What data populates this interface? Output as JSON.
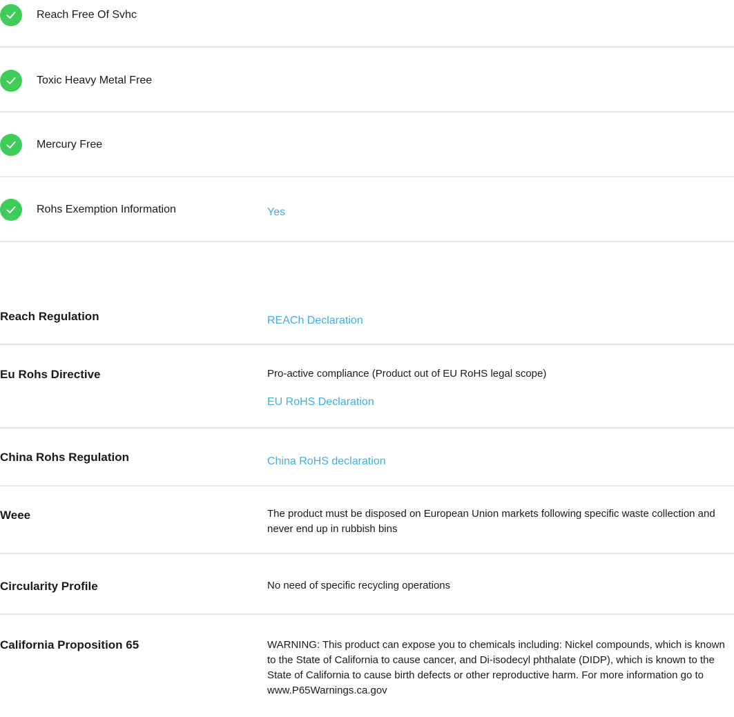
{
  "checks": [
    {
      "label": "Reach Free Of Svhc"
    },
    {
      "label": "Toxic Heavy Metal Free"
    },
    {
      "label": "Mercury Free"
    },
    {
      "label": "Rohs Exemption Information",
      "value": "Yes"
    }
  ],
  "specs": [
    {
      "label": "Reach Regulation",
      "link": "REACh Declaration"
    },
    {
      "label": "Eu Rohs Directive",
      "text": "Pro-active compliance (Product out of EU RoHS legal scope)",
      "link": "EU RoHS Declaration"
    },
    {
      "label": "China Rohs Regulation",
      "link": "China RoHS declaration"
    },
    {
      "label": "Weee",
      "text": "The product must be disposed on European Union markets following specific waste collection and never end up in rubbish bins"
    },
    {
      "label": "Circularity Profile",
      "text": "No need of specific recycling operations"
    },
    {
      "label": "California Proposition 65",
      "text": "WARNING: This product can expose you to chemicals including: Nickel compounds, which is known to the State of California to cause cancer, and Di-isodecyl phthalate (DIDP), which is known to the State of California to cause birth defects or other reproductive harm. For more information go to www.P65Warnings.ca.gov"
    }
  ],
  "colors": {
    "check_green": "#3dcd58",
    "link_blue": "#3dafe0",
    "divider": "#e6e6e6"
  },
  "icons": {
    "check": "check-circle-icon"
  }
}
